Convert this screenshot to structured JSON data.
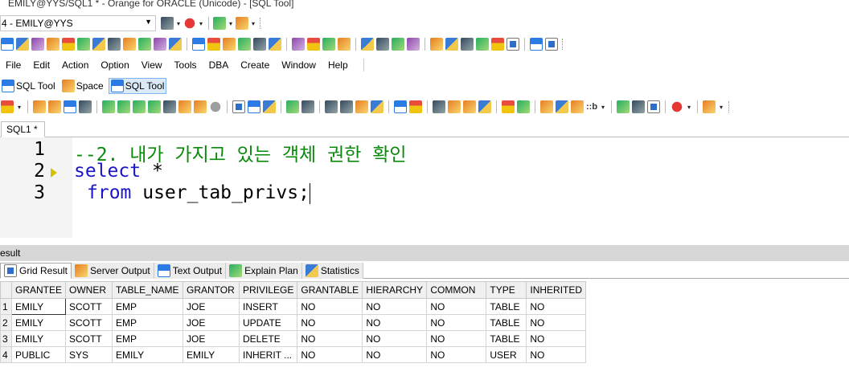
{
  "window": {
    "title": "EMILY@YYS/SQL1 * - Orange for ORACLE (Unicode) - [SQL Tool]"
  },
  "connection": {
    "selected": "4 - EMILY@YYS"
  },
  "menu": [
    "File",
    "Edit",
    "Action",
    "Option",
    "View",
    "Tools",
    "DBA",
    "Create",
    "Window",
    "Help"
  ],
  "window_tabs": [
    {
      "label": "SQL Tool",
      "icon": "sql-icon"
    },
    {
      "label": "Space",
      "icon": "space-icon"
    },
    {
      "label": "SQL Tool",
      "icon": "sql-icon",
      "active": true
    }
  ],
  "toolbar2": {
    "bind_label": "::b"
  },
  "document_tab": {
    "label": "SQL1 *"
  },
  "editor": {
    "lines": [
      {
        "number": "1",
        "text": "--2. 내가 가지고 있는 객체 권한 확인"
      },
      {
        "number": "2",
        "keyword": "select",
        "rest": " *"
      },
      {
        "number": "3",
        "keyword": "from",
        "rest": " user_tab_privs;"
      }
    ]
  },
  "result": {
    "title": "esult",
    "tabs": [
      "Grid Result",
      "Server Output",
      "Text Output",
      "Explain Plan",
      "Statistics"
    ],
    "columns": [
      "GRANTEE",
      "OWNER",
      "TABLE_NAME",
      "GRANTOR",
      "PRIVILEGE",
      "GRANTABLE",
      "HIERARCHY",
      "COMMON",
      "TYPE",
      "INHERITED"
    ],
    "rows": [
      [
        "1",
        "EMILY",
        "SCOTT",
        "EMP",
        "JOE",
        "INSERT",
        "NO",
        "NO",
        "NO",
        "TABLE",
        "NO"
      ],
      [
        "2",
        "EMILY",
        "SCOTT",
        "EMP",
        "JOE",
        "UPDATE",
        "NO",
        "NO",
        "NO",
        "TABLE",
        "NO"
      ],
      [
        "3",
        "EMILY",
        "SCOTT",
        "EMP",
        "JOE",
        "DELETE",
        "NO",
        "NO",
        "NO",
        "TABLE",
        "NO"
      ],
      [
        "4",
        "PUBLIC",
        "SYS",
        "EMILY",
        "EMILY",
        "INHERIT ...",
        "NO",
        "NO",
        "NO",
        "USER",
        "NO"
      ]
    ]
  }
}
